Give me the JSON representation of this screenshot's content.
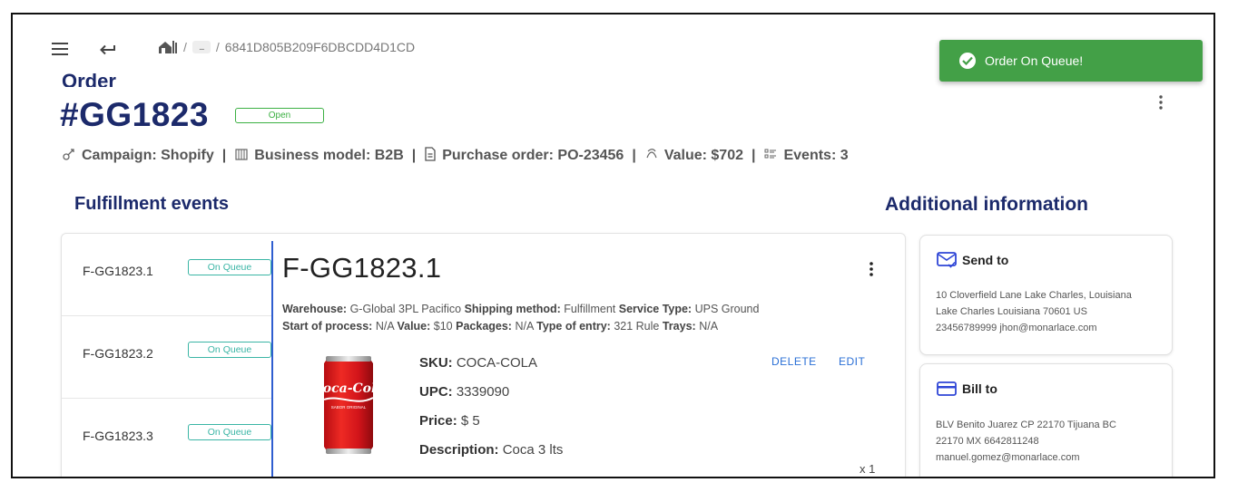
{
  "topbar": {
    "breadcrumb_sep1": "/",
    "breadcrumb_more": "...",
    "breadcrumb_sep2": "/",
    "breadcrumb_current": "6841D805B209F6DBCDD4D1CD"
  },
  "toast": {
    "message": "Order On Queue!",
    "color": "#43a047"
  },
  "order": {
    "label": "Order",
    "number": "#GG1823",
    "status": "Open",
    "meta": {
      "campaign": "Campaign: Shopify",
      "business_model": "Business model: B2B",
      "purchase_order": "Purchase order: PO-23456",
      "value": "Value: $702",
      "events": "Events: 3",
      "separator": "|"
    }
  },
  "sections": {
    "fulfillment": "Fulfillment events",
    "additional": "Additional information"
  },
  "events": [
    {
      "name": "F-GG1823.1",
      "status": "On Queue"
    },
    {
      "name": "F-GG1823.2",
      "status": "On Queue"
    },
    {
      "name": "F-GG1823.3",
      "status": "On Queue"
    }
  ],
  "detail": {
    "title": "F-GG1823.1",
    "warehouse_label": "Warehouse:",
    "warehouse": "G-Global 3PL Pacifico",
    "shipping_label": "Shipping method:",
    "shipping": "Fulfillment",
    "service_label": "Service Type:",
    "service": "UPS Ground",
    "start_label": "Start of process:",
    "start": "N/A",
    "value_label": "Value:",
    "value": "$10",
    "packages_label": "Packages:",
    "packages": "N/A",
    "entry_label": "Type of entry:",
    "entry": "321 Rule",
    "trays_label": "Trays:",
    "trays": "N/A",
    "product": {
      "sku_label": "SKU:",
      "sku": "COCA-COLA",
      "upc_label": "UPC:",
      "upc": "3339090",
      "price_label": "Price:",
      "price": "$ 5",
      "desc_label": "Description:",
      "desc": "Coca 3 lts",
      "qty": "x 1",
      "delete": "DELETE",
      "edit": "EDIT",
      "image_brand": "Coca-Cola",
      "image_small_1": "SABOR ORIGINAL"
    }
  },
  "send_to": {
    "title": "Send to",
    "line1": "10 Cloverfield Lane Lake Charles, Louisiana",
    "line2": "Lake Charles Louisiana 70601 US",
    "line3": "23456789999 jhon@monarlace.com"
  },
  "bill_to": {
    "title": "Bill to",
    "line1": "BLV Benito Juarez CP 22170 Tijuana BC",
    "line2": "22170 MX 6642811248",
    "line3": "manuel.gomez@monarlace.com"
  },
  "colors": {
    "brand_navy": "#1c2a6b",
    "link_blue": "#2a6fd6",
    "badge_teal": "#3ab5a5",
    "open_green": "#3cb043"
  }
}
